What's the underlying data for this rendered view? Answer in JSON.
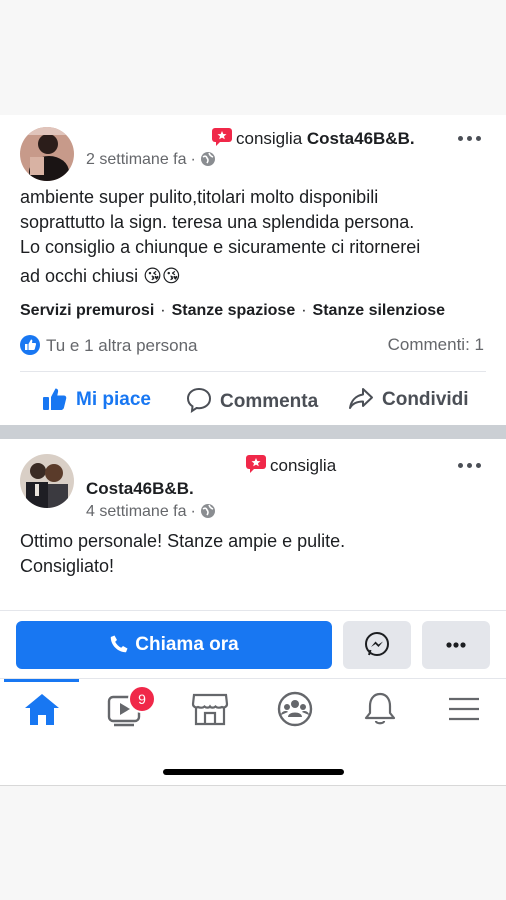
{
  "post1": {
    "author_name": "",
    "action": "consiglia",
    "page": "Costa46B&B.",
    "time": "2 settimane fa",
    "text_lines": [
      "ambiente super pulito,titolari molto disponibili",
      "soprattutto la sign. teresa una splendida persona.",
      "Lo consiglio a chiunque e sicuramente ci ritornerei",
      "ad occhi chiusi 😘😘"
    ],
    "tags": [
      "Servizi premurosi",
      "Stanze spaziose",
      "Stanze silenziose"
    ],
    "reactions": "Tu e 1 altra persona",
    "comments": "Commenti: 1"
  },
  "actions": {
    "like": "Mi piace",
    "comment": "Commenta",
    "share": "Condividi"
  },
  "post2": {
    "author_name": "",
    "action": "consiglia",
    "page": "Costa46B&B.",
    "time": "4 settimane fa",
    "text_lines": [
      "Ottimo personale! Stanze ampie e pulite.",
      "Consigliato!"
    ]
  },
  "cta": {
    "call_label": "Chiama ora"
  },
  "tabbar": {
    "video_badge": "9",
    "icons": [
      "home-icon",
      "video-icon",
      "marketplace-icon",
      "groups-icon",
      "notifications-icon",
      "menu-icon"
    ]
  },
  "colors": {
    "brand": "#1877f2",
    "badge": "#f02849",
    "recommend": "#f02849"
  }
}
